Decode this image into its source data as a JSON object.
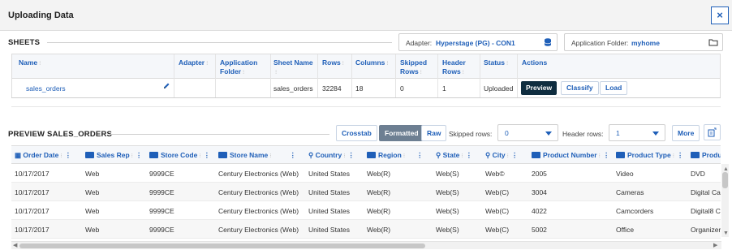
{
  "window": {
    "title": "Uploading Data",
    "close_glyph": "×"
  },
  "sheets": {
    "section_title": "SHEETS",
    "adapter_label": "Adapter:",
    "adapter_value": "Hyperstage (PG) - CON1",
    "folder_label": "Application Folder:",
    "folder_value": "myhome",
    "columns": [
      "Name",
      "Adapter",
      "Application Folder",
      "Sheet Name",
      "Rows",
      "Columns",
      "Skipped Rows",
      "Header Rows",
      "Status",
      "Actions"
    ],
    "row": {
      "name": "sales_orders",
      "adapter": "",
      "application_folder": "",
      "sheet_name": "sales_orders",
      "rows": "32284",
      "columns": "18",
      "skipped_rows": "0",
      "header_rows": "1",
      "status": "Uploaded"
    },
    "actions": {
      "preview": "Preview",
      "classify": "Classify",
      "load": "Load"
    }
  },
  "preview": {
    "section_title": "PREVIEW SALES_ORDERS",
    "crosstab": "Crosstab",
    "formatted": "Formatted",
    "raw": "Raw",
    "skipped_rows_label": "Skipped rows:",
    "skipped_rows_value": "0",
    "header_rows_label": "Header rows:",
    "header_rows_value": "1",
    "more": "More",
    "columns": [
      "Order Date",
      "Sales Rep",
      "Store Code",
      "Store Name",
      "Country",
      "Region",
      "State",
      "City",
      "Product Number",
      "Product Type",
      "Product C"
    ],
    "rows": [
      [
        "10/17/2017",
        "Web",
        "9999CE",
        "Century Electronics (Web)",
        "United States",
        "Web(R)",
        "Web(S)",
        "Web©",
        "2005",
        "Video",
        "DVD"
      ],
      [
        "10/17/2017",
        "Web",
        "9999CE",
        "Century Electronics (Web)",
        "United States",
        "Web(R)",
        "Web(S)",
        "Web(C)",
        "3004",
        "Cameras",
        "Digital Ca"
      ],
      [
        "10/17/2017",
        "Web",
        "9999CE",
        "Century Electronics (Web)",
        "United States",
        "Web(R)",
        "Web(S)",
        "Web(C)",
        "4022",
        "Camcorders",
        "Digital8 C"
      ],
      [
        "10/17/2017",
        "Web",
        "9999CE",
        "Century Electronics (Web)",
        "United States",
        "Web(R)",
        "Web(S)",
        "Web(C)",
        "5002",
        "Office",
        "Organizer"
      ]
    ]
  },
  "icons": {
    "database": "database-icon",
    "folder": "folder-icon",
    "edit": "pencil-icon",
    "calendar": "calendar-icon",
    "location": "location-icon",
    "text_type": "abc-icon",
    "sort": "sort-icon",
    "menu": "kebab-menu-icon",
    "export": "export-icon"
  },
  "colors": {
    "accent": "#1f5fb8",
    "dark_button": "#0f2d3f",
    "active_toggle": "#6d7f92"
  }
}
